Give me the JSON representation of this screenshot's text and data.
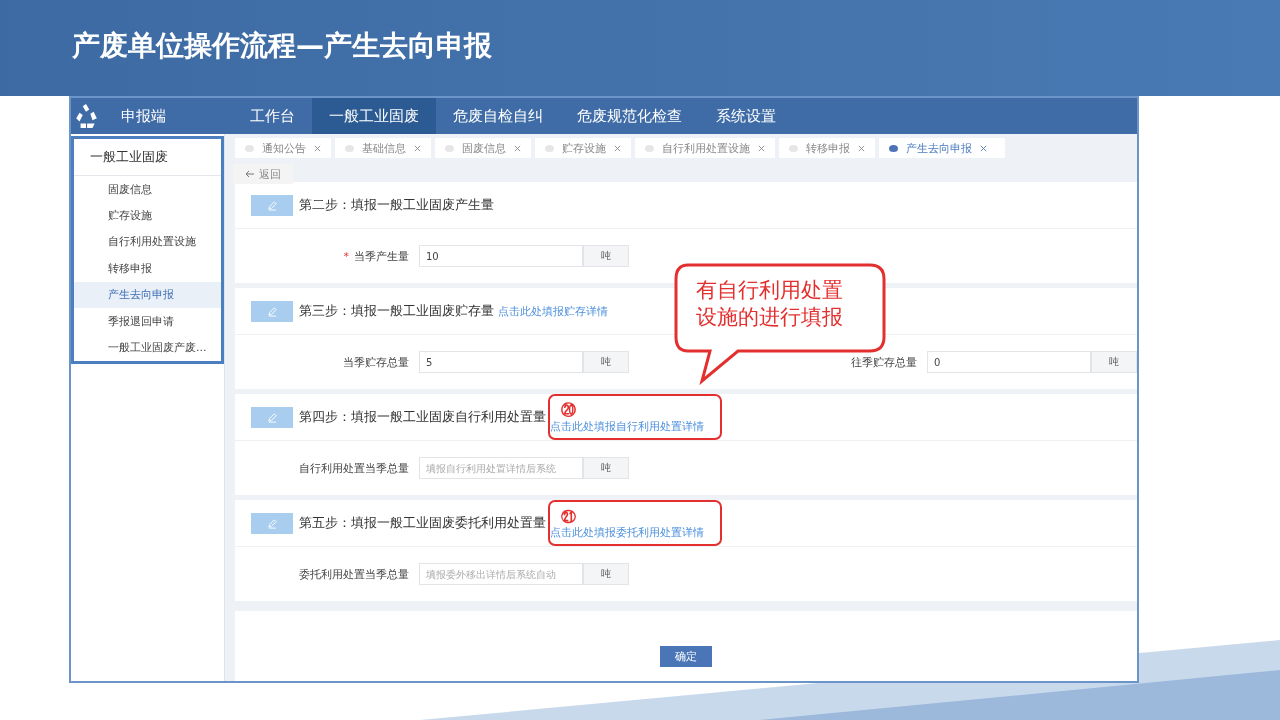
{
  "slide": {
    "title": "产废单位操作流程—产生去向申报"
  },
  "app": {
    "brand": "申报端",
    "nav": [
      {
        "label": "工作台",
        "selected": false
      },
      {
        "label": "一般工业固废",
        "selected": true
      },
      {
        "label": "危废自检自纠",
        "selected": false
      },
      {
        "label": "危废规范化检查",
        "selected": false
      },
      {
        "label": "系统设置",
        "selected": false
      }
    ],
    "sidebar": {
      "heading": "一般工业固废",
      "items": [
        {
          "label": "固废信息",
          "selected": false
        },
        {
          "label": "贮存设施",
          "selected": false
        },
        {
          "label": "自行利用处置设施",
          "selected": false
        },
        {
          "label": "转移申报",
          "selected": false
        },
        {
          "label": "产生去向申报",
          "selected": true
        },
        {
          "label": "季报退回申请",
          "selected": false
        },
        {
          "label": "一般工业固废产废...",
          "selected": false
        }
      ]
    },
    "tabs": [
      {
        "label": "通知公告",
        "selected": false
      },
      {
        "label": "基础信息",
        "selected": false
      },
      {
        "label": "固废信息",
        "selected": false
      },
      {
        "label": "贮存设施",
        "selected": false
      },
      {
        "label": "自行利用处置设施",
        "selected": false
      },
      {
        "label": "转移申报",
        "selected": false
      },
      {
        "label": "产生去向申报",
        "selected": true
      }
    ],
    "back": "返回",
    "steps": [
      {
        "title": "第二步：填报一般工业固废产生量",
        "fields": [
          {
            "label": "当季产生量",
            "mark": "*",
            "value": "10",
            "unit": "吨"
          }
        ]
      },
      {
        "title": "第三步：填报一般工业固废贮存量",
        "link": "点击此处填报贮存详情",
        "fields": [
          {
            "label": "当季贮存总量",
            "value": "5",
            "unit": "吨"
          },
          {
            "label": "往季贮存总量",
            "value": "0",
            "unit": "吨"
          }
        ]
      },
      {
        "title": "第四步：填报一般工业固废自行利用处置量",
        "annotation": "⑳",
        "link": "点击此处填报自行利用处置详情",
        "fields": [
          {
            "label": "自行利用处置当季总量",
            "placeholder": "填报自行利用处置详情后系统",
            "unit": "吨"
          }
        ]
      },
      {
        "title": "第五步：填报一般工业固废委托利用处置量",
        "annotation": "㉑",
        "link": "点击此处填报委托利用处置详情",
        "fields": [
          {
            "label": "委托利用处置当季总量",
            "placeholder": "填报委外移出详情后系统自动",
            "unit": "吨"
          }
        ]
      }
    ],
    "confirm": "确定"
  },
  "callout": {
    "lines": [
      "有自行利用处置",
      "设施的进行填报"
    ]
  }
}
